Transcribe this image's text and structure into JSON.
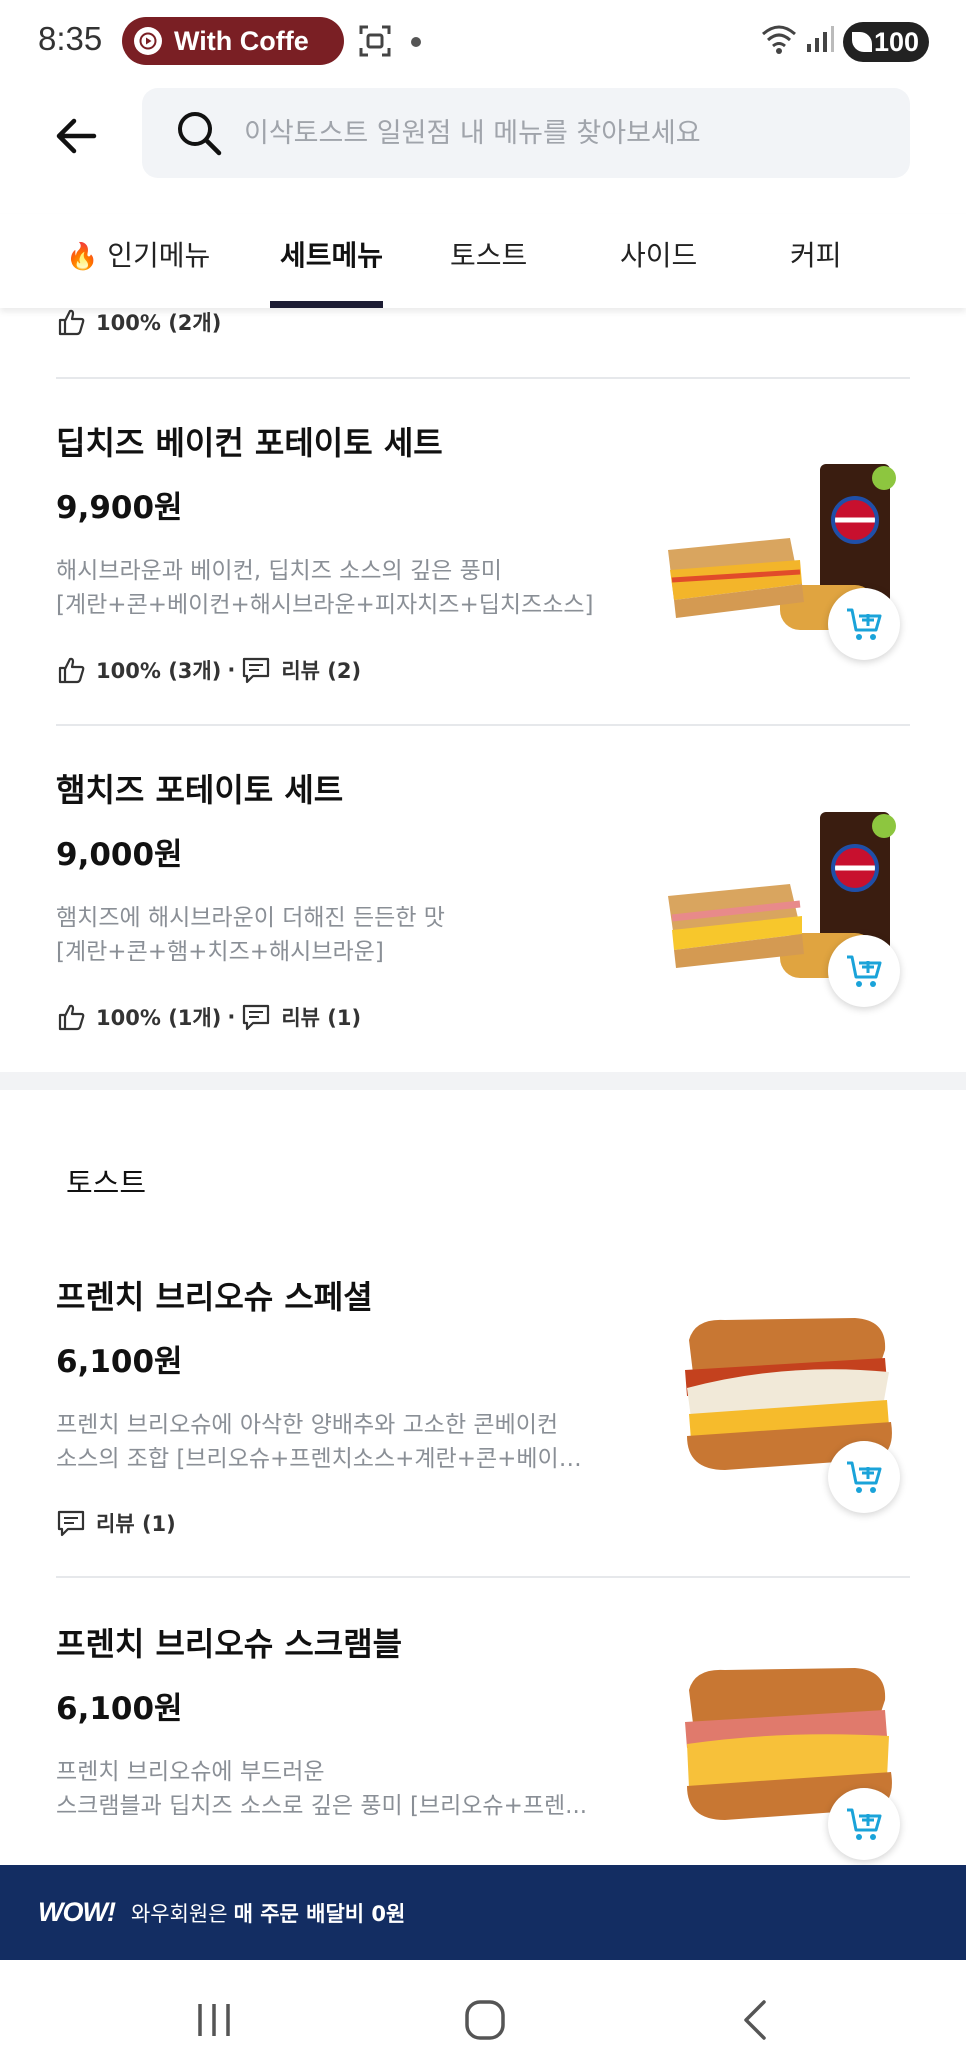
{
  "status_bar": {
    "time": "8:35",
    "pill_text": "With Coffe",
    "battery": "100"
  },
  "header": {
    "search_placeholder": "이삭토스트 일원점 내 메뉴를 찾아보세요"
  },
  "tabs": [
    {
      "label": "인기메뉴",
      "icon": "fire-icon"
    },
    {
      "label": "세트메뉴",
      "active": true
    },
    {
      "label": "토스트"
    },
    {
      "label": "사이드"
    },
    {
      "label": "커피"
    }
  ],
  "partial_item": {
    "likes": "100% (2개)"
  },
  "set_items": [
    {
      "name": "딥치즈 베이컨 포테이토 세트",
      "price": "9,900원",
      "desc1": "해시브라운과 베이컨, 딥치즈 소스의 깊은 풍미",
      "desc2": "[계란+콘+베이컨+해시브라운+피자치즈+딥치즈소스]",
      "likes": "100% (3개)",
      "reviews": "리뷰 (2)"
    },
    {
      "name": "햄치즈 포테이토 세트",
      "price": "9,000원",
      "desc1": "햄치즈에 해시브라운이 더해진 든든한 맛",
      "desc2": "[계란+콘+햄+치즈+해시브라운]",
      "likes": "100% (1개)",
      "reviews": "리뷰 (1)"
    }
  ],
  "toast_section": {
    "title": "토스트",
    "items": [
      {
        "name": "프렌치 브리오슈 스페셜",
        "price": "6,100원",
        "desc1": "프렌치 브리오슈에 아삭한 양배추와 고소한 콘베이컨",
        "desc2": "소스의 조합 [브리오슈+프렌치소스+계란+콘+베이컨...",
        "reviews": "리뷰 (1)"
      },
      {
        "name": "프렌치 브리오슈 스크램블",
        "price": "6,100원",
        "desc1": "프렌치 브리오슈에 부드러운",
        "desc2": "스크램블과 딥치즈 소스로 깊은 풍미 [브리오슈+프렌..."
      }
    ]
  },
  "wow_banner": {
    "logo": "WOW!",
    "text": "와우회원은",
    "bold_text": "매 주문 배달비 0원"
  },
  "colors": {
    "banner": "#132d62",
    "cart_icon": "#1aa3d9",
    "active_tab_underline": "#1d1d34"
  }
}
